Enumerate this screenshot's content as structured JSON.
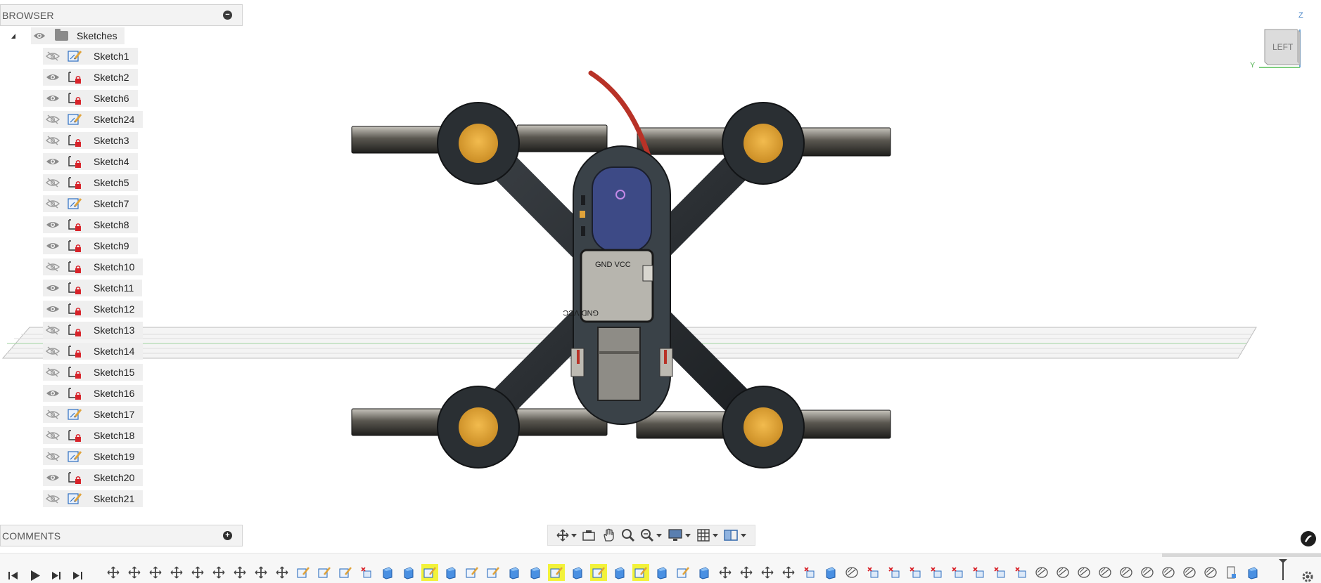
{
  "browser": {
    "title": "BROWSER",
    "collapse_symbol": "−",
    "root": {
      "label": "Sketches",
      "expanded": true,
      "visible": true
    },
    "sketches": [
      {
        "label": "Sketch1",
        "visible": false,
        "status": "profile"
      },
      {
        "label": "Sketch2",
        "visible": true,
        "status": "locked"
      },
      {
        "label": "Sketch6",
        "visible": true,
        "status": "locked"
      },
      {
        "label": "Sketch24",
        "visible": false,
        "status": "profile"
      },
      {
        "label": "Sketch3",
        "visible": false,
        "status": "locked"
      },
      {
        "label": "Sketch4",
        "visible": true,
        "status": "locked"
      },
      {
        "label": "Sketch5",
        "visible": false,
        "status": "locked"
      },
      {
        "label": "Sketch7",
        "visible": false,
        "status": "profile"
      },
      {
        "label": "Sketch8",
        "visible": true,
        "status": "locked"
      },
      {
        "label": "Sketch9",
        "visible": true,
        "status": "locked"
      },
      {
        "label": "Sketch10",
        "visible": false,
        "status": "locked"
      },
      {
        "label": "Sketch11",
        "visible": true,
        "status": "locked"
      },
      {
        "label": "Sketch12",
        "visible": true,
        "status": "locked"
      },
      {
        "label": "Sketch13",
        "visible": false,
        "status": "locked"
      },
      {
        "label": "Sketch14",
        "visible": false,
        "status": "locked"
      },
      {
        "label": "Sketch15",
        "visible": false,
        "status": "locked"
      },
      {
        "label": "Sketch16",
        "visible": true,
        "status": "locked"
      },
      {
        "label": "Sketch17",
        "visible": false,
        "status": "profile"
      },
      {
        "label": "Sketch18",
        "visible": false,
        "status": "locked"
      },
      {
        "label": "Sketch19",
        "visible": false,
        "status": "profile"
      },
      {
        "label": "Sketch20",
        "visible": true,
        "status": "locked"
      },
      {
        "label": "Sketch21",
        "visible": false,
        "status": "profile"
      }
    ]
  },
  "comments": {
    "title": "COMMENTS",
    "add_symbol": "+"
  },
  "viewcube": {
    "face": "LEFT",
    "axis_z": "Z",
    "axis_y": "Y"
  },
  "model": {
    "board_label_top": "GND VCC",
    "board_label_bottom": "GND VCC"
  },
  "navbar": {
    "tools": [
      "orbit-icon",
      "look-at-icon",
      "pan-icon",
      "zoom-icon",
      "fit-icon",
      "display-settings-icon",
      "grid-settings-icon",
      "viewports-icon"
    ]
  },
  "timeline": {
    "controls": [
      "go-to-start",
      "step-back",
      "play",
      "step-forward",
      "go-to-end"
    ],
    "features": [
      "joint",
      "joint",
      "joint",
      "joint",
      "joint",
      "joint",
      "joint",
      "joint",
      "joint",
      "sketch",
      "sketch",
      "sketch",
      "extrude-red",
      "body",
      "body",
      "sketch-hl",
      "body",
      "sketch",
      "sketch",
      "body",
      "body",
      "sketch-hl",
      "body",
      "sketch-hl",
      "body",
      "sketch-hl",
      "body",
      "sketch",
      "body",
      "joint",
      "joint",
      "joint",
      "joint",
      "extrude-red",
      "body",
      "pattern",
      "move",
      "move",
      "move",
      "move",
      "move",
      "move",
      "move",
      "move",
      "pattern",
      "pattern",
      "pattern",
      "pattern",
      "pattern",
      "pattern",
      "pattern",
      "pattern",
      "pattern",
      "plane",
      "body"
    ]
  },
  "colors": {
    "panel_bg": "#f3f3f3",
    "item_bg": "#efefef",
    "highlight": "#f2f23a",
    "motor_hub": "#e0a33a",
    "frame_dark": "#2b3238",
    "blade": "#4a4a42",
    "battery": "#3d4a86",
    "wire": "#b83227"
  }
}
